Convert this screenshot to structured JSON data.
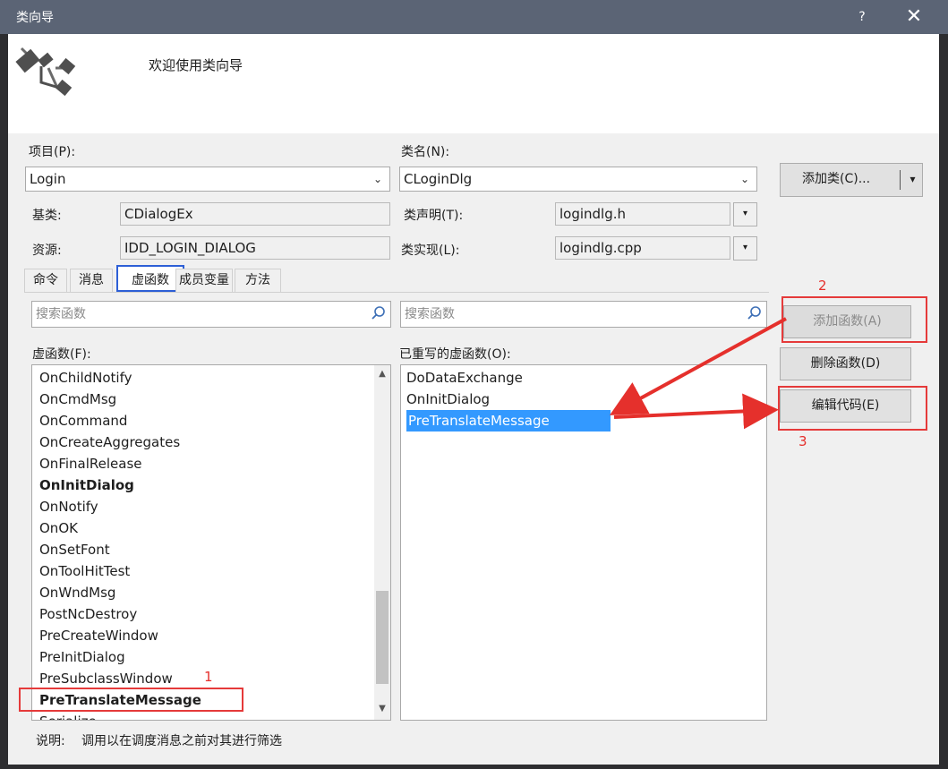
{
  "window": {
    "title": "类向导",
    "help_glyph": "?",
    "close_glyph": "✕",
    "welcome_text": "欢迎使用类向导"
  },
  "project": {
    "label": "项目(P):",
    "value": "Login"
  },
  "class_name": {
    "label": "类名(N):",
    "value": "CLoginDlg"
  },
  "add_class_button": {
    "label": "添加类(C)...",
    "arrow": "▾"
  },
  "base_class": {
    "label": "基类:",
    "value": "CDialogEx"
  },
  "resource": {
    "label": "资源:",
    "value": "IDD_LOGIN_DIALOG"
  },
  "class_declaration": {
    "label": "类声明(T):",
    "value": "logindlg.h"
  },
  "class_implementation": {
    "label": "类实现(L):",
    "value": "logindlg.cpp"
  },
  "tabs": [
    {
      "label": "命令",
      "active": false
    },
    {
      "label": "消息",
      "active": false
    },
    {
      "label": "虚函数",
      "active": true
    },
    {
      "label": "成员变量",
      "active": false
    },
    {
      "label": "方法",
      "active": false
    }
  ],
  "left_search": {
    "placeholder": "搜索函数"
  },
  "right_search": {
    "placeholder": "搜索函数"
  },
  "virtual_functions": {
    "label": "虚函数(F):",
    "items": [
      {
        "name": "OnChildNotify",
        "bold": false
      },
      {
        "name": "OnCmdMsg",
        "bold": false
      },
      {
        "name": "OnCommand",
        "bold": false
      },
      {
        "name": "OnCreateAggregates",
        "bold": false
      },
      {
        "name": "OnFinalRelease",
        "bold": false
      },
      {
        "name": "OnInitDialog",
        "bold": true
      },
      {
        "name": "OnNotify",
        "bold": false
      },
      {
        "name": "OnOK",
        "bold": false
      },
      {
        "name": "OnSetFont",
        "bold": false
      },
      {
        "name": "OnToolHitTest",
        "bold": false
      },
      {
        "name": "OnWndMsg",
        "bold": false
      },
      {
        "name": "PostNcDestroy",
        "bold": false
      },
      {
        "name": "PreCreateWindow",
        "bold": false
      },
      {
        "name": "PreInitDialog",
        "bold": false
      },
      {
        "name": "PreSubclassWindow",
        "bold": false
      },
      {
        "name": "PreTranslateMessage",
        "bold": true
      },
      {
        "name": "Serialize",
        "bold": false
      }
    ],
    "selected": "PreTranslateMessage"
  },
  "overridden_functions": {
    "label": "已重写的虚函数(O):",
    "items": [
      "DoDataExchange",
      "OnInitDialog",
      "PreTranslateMessage"
    ],
    "selected": "PreTranslateMessage"
  },
  "buttons": {
    "add_function": "添加函数(A)",
    "delete_function": "删除函数(D)",
    "edit_code": "编辑代码(E)"
  },
  "description": {
    "label": "说明:",
    "text": "调用以在调度消息之前对其进行筛选"
  },
  "annotations": {
    "step1": "1",
    "step2": "2",
    "step3": "3"
  },
  "colors": {
    "titlebar": "#5b6475",
    "selection": "#3399ff",
    "annotation_red": "#e5302c",
    "tab_highlight": "#2d5fd6"
  }
}
